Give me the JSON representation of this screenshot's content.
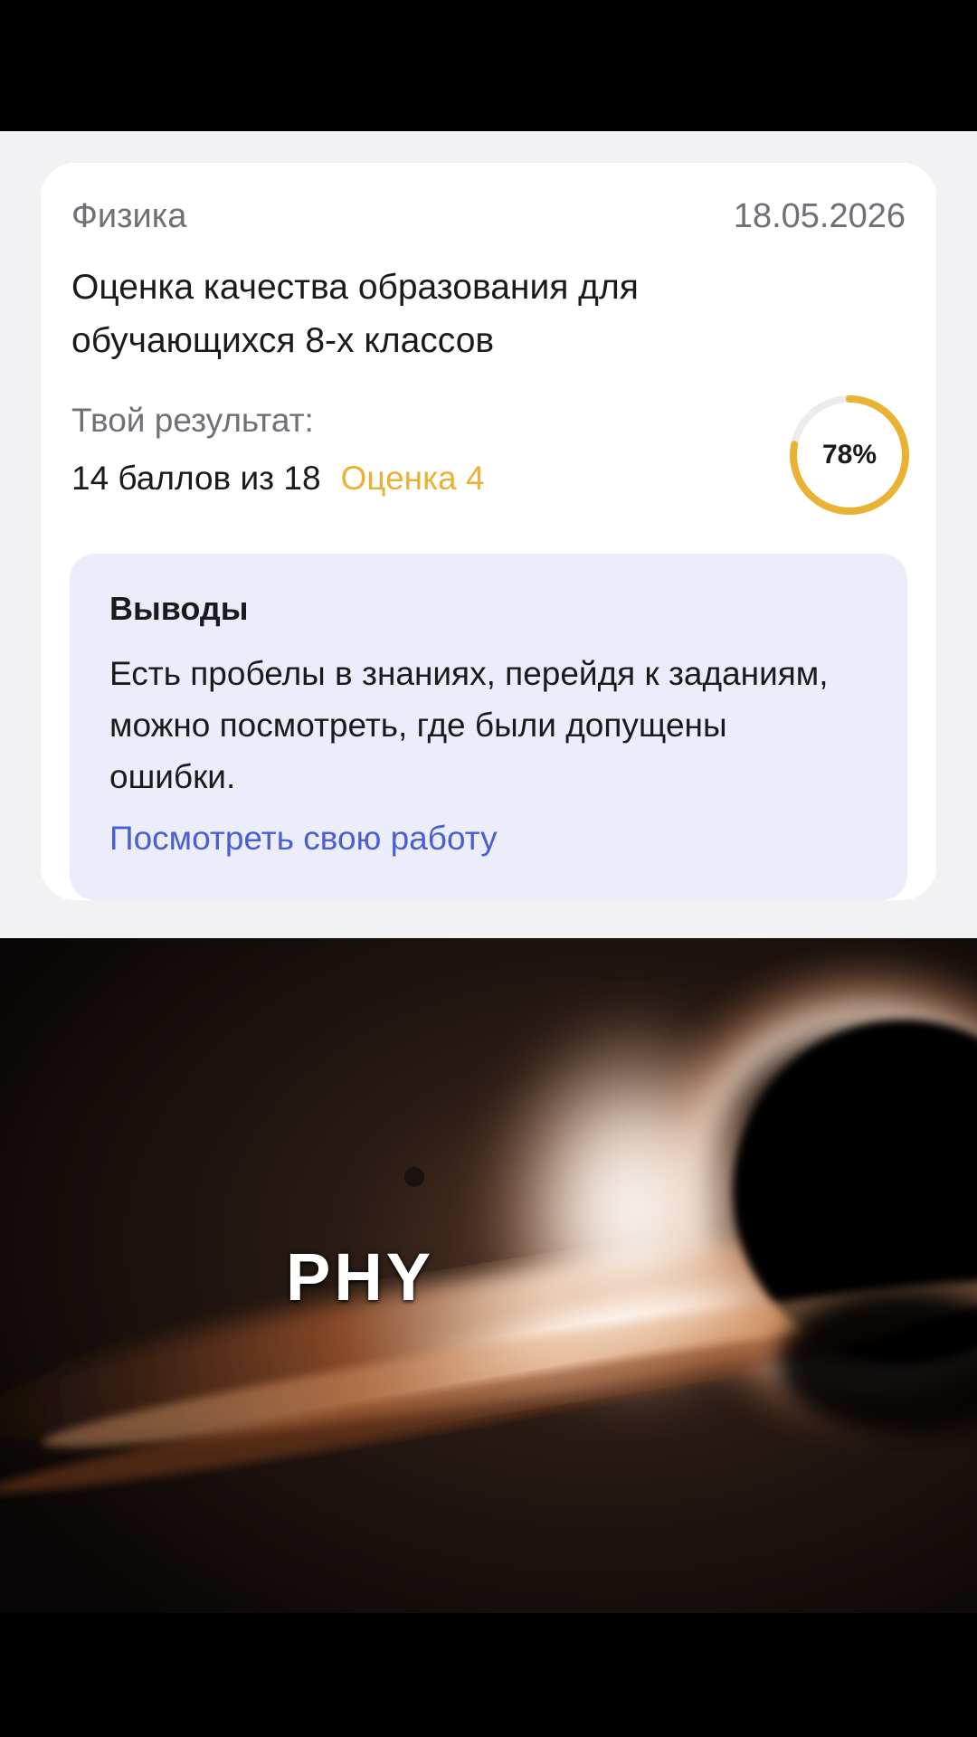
{
  "result_card": {
    "subject": "Физика",
    "date": "18.05.2026",
    "title": "Оценка качества образования для обучающихся 8-х классов",
    "your_result_label": "Твой результат:",
    "score_text": "14 баллов из 18",
    "grade_text": "Оценка 4",
    "progress_text": "78%",
    "progress_value": 0.78,
    "accent_color": "#e9b233",
    "link_color": "#4a60d1"
  },
  "conclusions": {
    "title": "Выводы",
    "text": "Есть пробелы в знаниях, перейдя к заданиям, можно посмотреть, где были допущены ошибки.",
    "link_label": "Посмотреть свою работу"
  },
  "video": {
    "caption": "PHY",
    "scene": "black-hole-image"
  }
}
